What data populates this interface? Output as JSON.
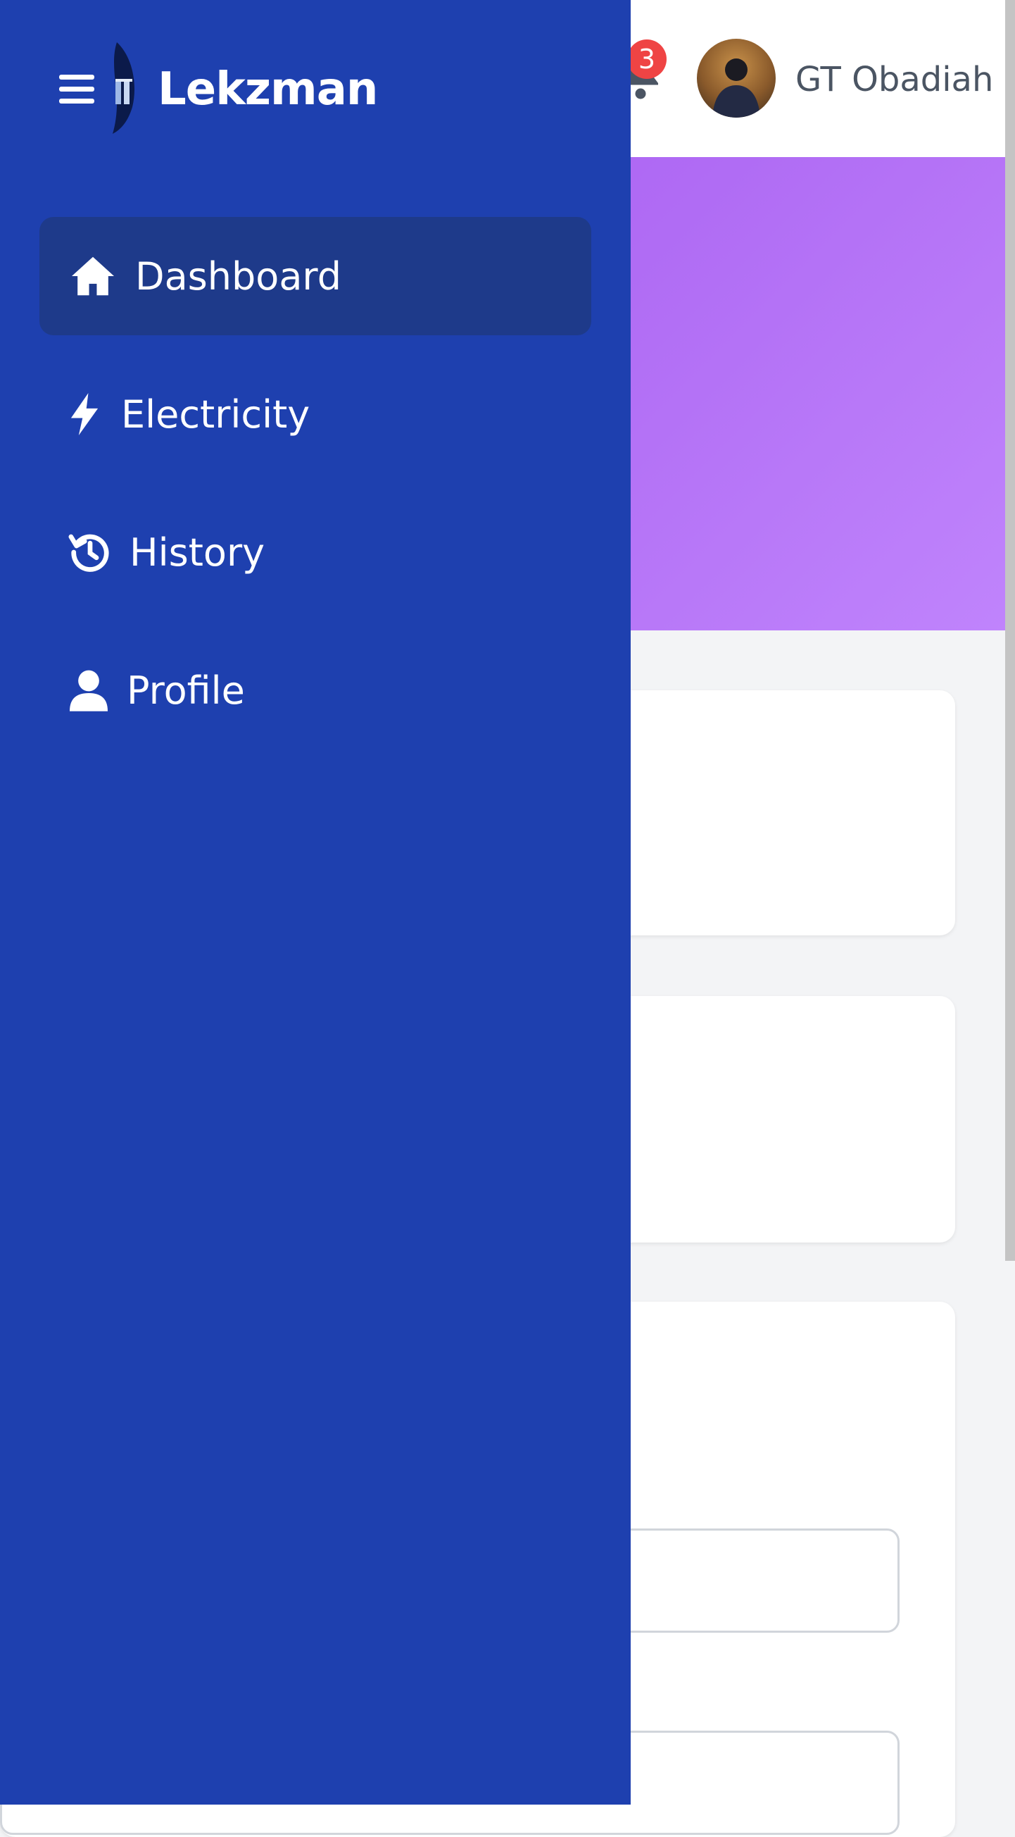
{
  "app": {
    "brand": "Lekzman"
  },
  "header": {
    "notification_count": "3",
    "user_name": "GT Obadiah"
  },
  "sidebar": {
    "items": [
      {
        "label": "Dashboard",
        "icon": "home-icon",
        "active": true
      },
      {
        "label": "Electricity",
        "icon": "lightning-icon",
        "active": false
      },
      {
        "label": "History",
        "icon": "history-icon",
        "active": false
      },
      {
        "label": "Profile",
        "icon": "user-icon",
        "active": false
      }
    ]
  },
  "colors": {
    "sidebar_bg": "#1e40af",
    "active_item_bg": "#1e3a8a",
    "hero_gradient_start": "#a855f7",
    "hero_gradient_end": "#c084fc",
    "badge": "#ef4444"
  }
}
